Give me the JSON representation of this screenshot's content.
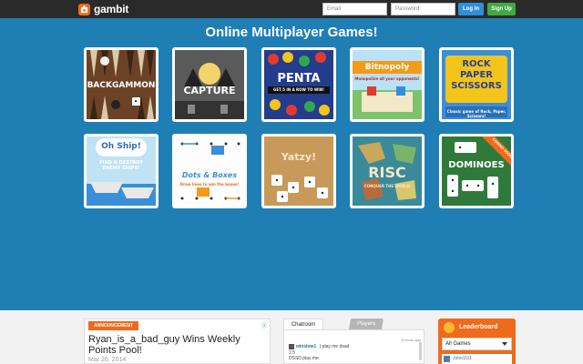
{
  "header": {
    "logo": "gambit",
    "email_placeholder": "Email",
    "password_placeholder": "Password",
    "login_label": "Log In",
    "signup_label": "Sign Up"
  },
  "hero": {
    "title": "Online Multiplayer Games!"
  },
  "games": [
    {
      "title": "BACKGAMMON"
    },
    {
      "title": "CAPTURE"
    },
    {
      "title": "PENTA",
      "tagline": "GET 5 IN A ROW TO WIN!"
    },
    {
      "title": "Bitnopoly",
      "tagline": "Monopolize all your opponents!"
    },
    {
      "title": "ROCK PAPER SCISSORS",
      "title_lines": [
        "ROCK",
        "PAPER",
        "SCISSORS"
      ],
      "tagline": "Classic game of Rock, Paper, Scissors!"
    },
    {
      "title": "Oh Ship!",
      "tagline": "FIND & DESTROY ENEMY SHIPS!",
      "tagline_lines": [
        "FIND & DESTROY",
        "ENEMY SHIPS!"
      ]
    },
    {
      "title": "Dots & Boxes",
      "tagline": "Draw lines to win the boxes!"
    },
    {
      "title": "Yatzy",
      "display_title": "Yatzy!"
    },
    {
      "title": "RISC",
      "tagline": "CONQUER THE WORLD"
    },
    {
      "title": "DOMINOES",
      "ribbon": "COMING SOON"
    }
  ],
  "announcement": {
    "badge": "ANNOUNCEMENT",
    "ad": "ⓐ",
    "title": "Ryan_is_a_bad_guy Wins Weekly Points Pool!",
    "date": "Mar 20, 2014"
  },
  "chat": {
    "tab_chatroom": "Chatroom",
    "tab_players": "Players",
    "time": "8 hours ago",
    "user": "winslow1",
    "message": "| play me dsad",
    "line2": "2.5",
    "line3": "DSSD play me"
  },
  "leaderboard": {
    "title": "Leaderboard",
    "select_value": "All Games",
    "first_user": "John1111"
  }
}
